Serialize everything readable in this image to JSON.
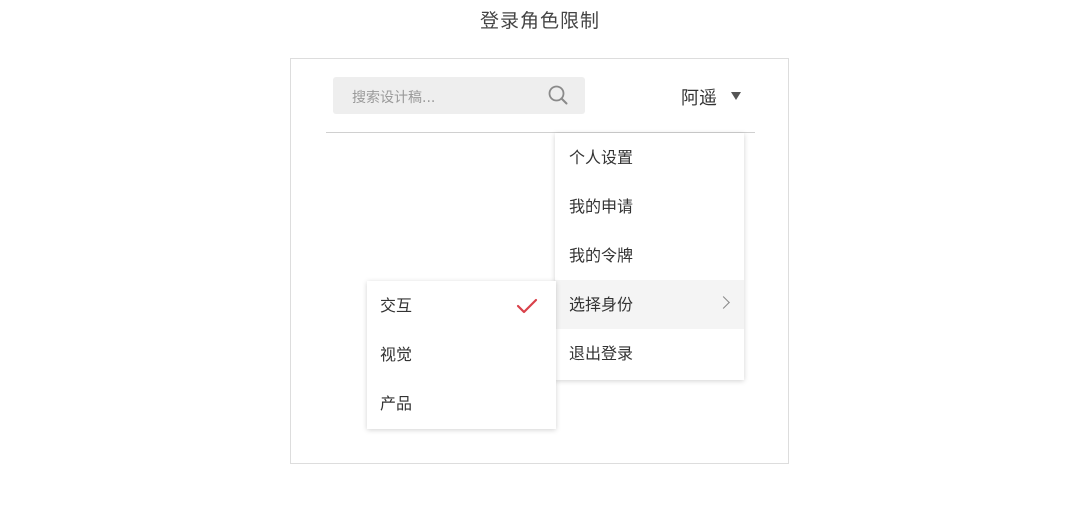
{
  "page": {
    "title": "登录角色限制"
  },
  "header": {
    "search": {
      "placeholder": "搜索设计稿...",
      "icon": "search-icon"
    },
    "user": {
      "name": "阿遥",
      "caret_icon": "caret-down-icon"
    }
  },
  "background": {
    "fragment": "?"
  },
  "user_menu": {
    "items": [
      {
        "label": "个人设置"
      },
      {
        "label": "我的申请"
      },
      {
        "label": "我的令牌"
      },
      {
        "label": "选择身份",
        "has_submenu": true,
        "active": true,
        "icon": "chevron-right-icon"
      },
      {
        "label": "退出登录"
      }
    ]
  },
  "role_menu": {
    "items": [
      {
        "label": "交互",
        "selected": true,
        "icon": "check-icon"
      },
      {
        "label": "视觉",
        "selected": false
      },
      {
        "label": "产品",
        "selected": false
      }
    ]
  },
  "colors": {
    "check": "#d9414a",
    "menu_active_bg": "#f4f4f4",
    "search_bg": "#eeeeee"
  }
}
